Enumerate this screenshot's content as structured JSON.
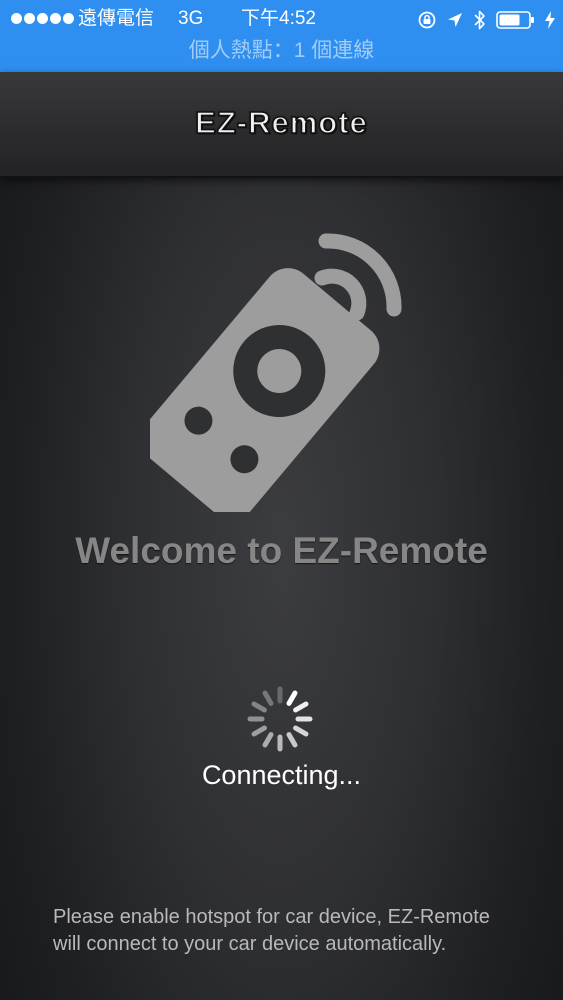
{
  "status_bar": {
    "carrier": "遠傳電信",
    "network": "3G",
    "time": "下午4:52",
    "hotspot_text": "個人熱點：1 個連線",
    "background_color": "#2f8ff0",
    "icons": [
      "signal-dots-icon",
      "rotation-lock-icon",
      "location-arrow-icon",
      "bluetooth-icon",
      "battery-icon",
      "charging-bolt-icon"
    ]
  },
  "nav_bar": {
    "title": "EZ-Remote"
  },
  "main": {
    "logo_icon": "remote-control-wireless-icon",
    "welcome": "Welcome to EZ-Remote",
    "spinner_icon": "activity-spinner-icon",
    "status": "Connecting...",
    "instructions": "Please enable hotspot for car device, EZ-Remote will connect to your car device automatically."
  },
  "colors": {
    "logo_gray": "#9d9d9d",
    "welcome_gray": "#868686",
    "background_dark": "#2e2f32"
  }
}
